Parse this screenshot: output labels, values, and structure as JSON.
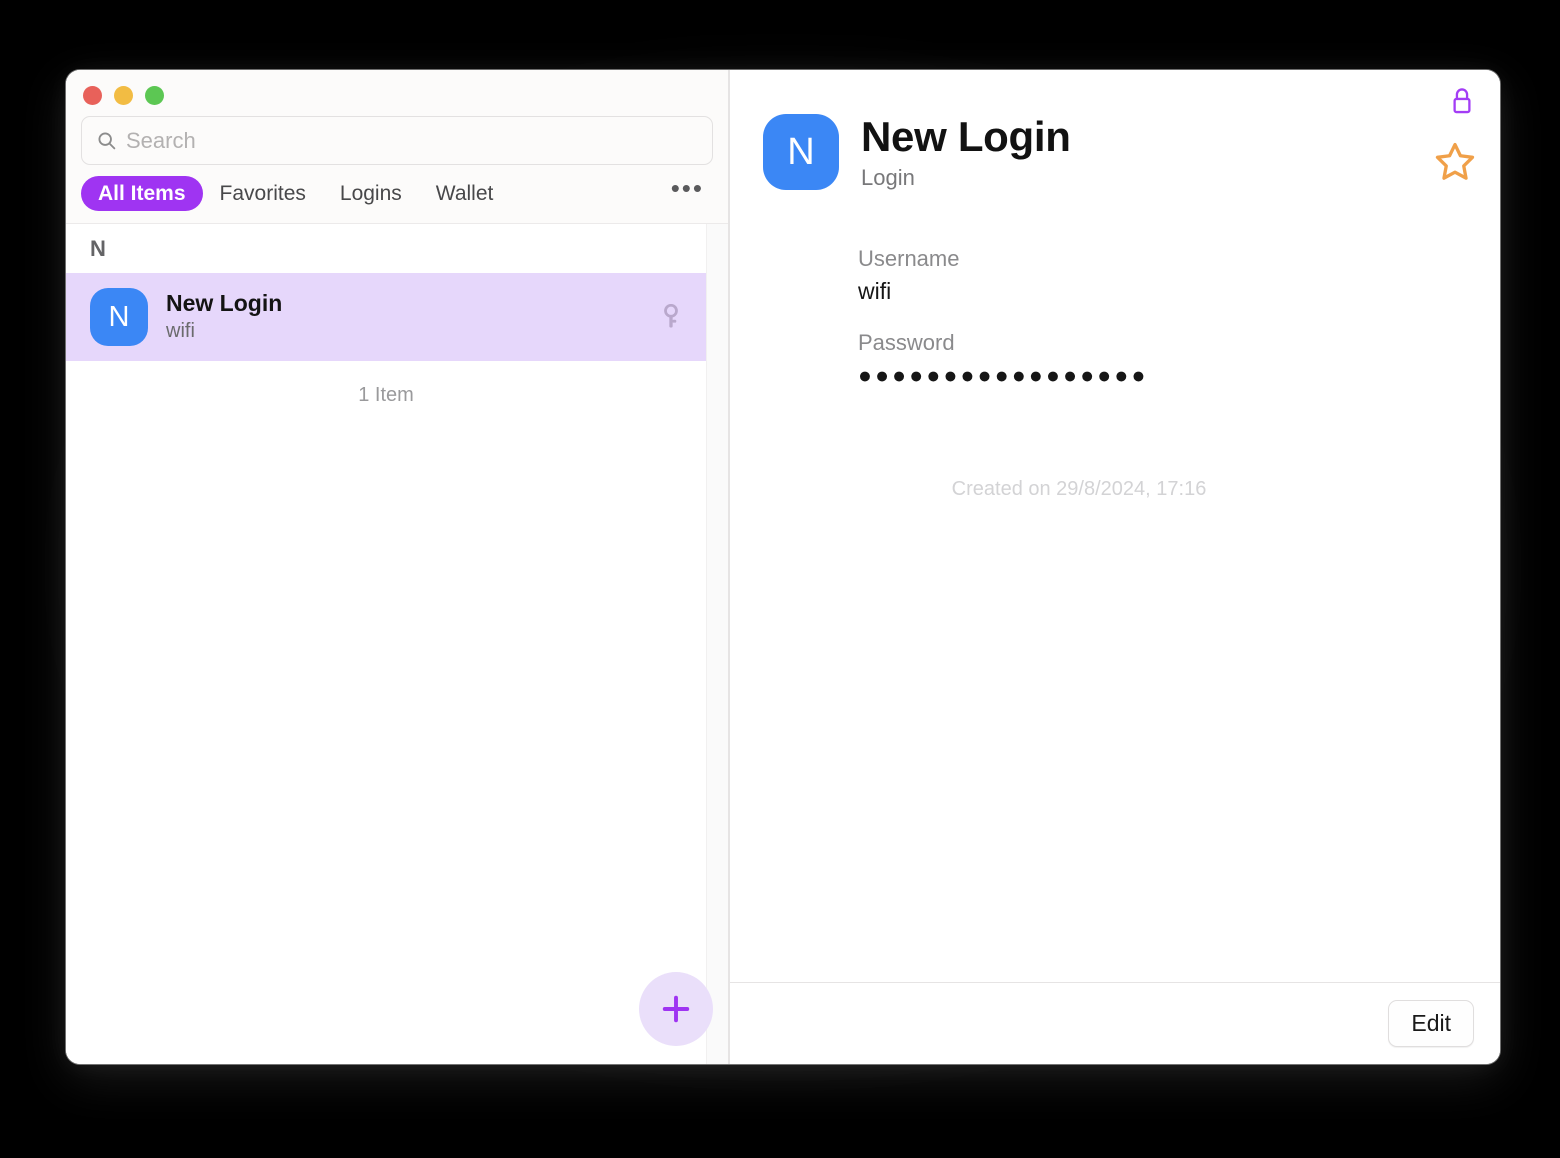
{
  "window": {
    "traffic_lights": [
      {
        "name": "close",
        "color": "#e8615a"
      },
      {
        "name": "minimize",
        "color": "#f2bc43"
      },
      {
        "name": "maximize",
        "color": "#5cc753"
      }
    ]
  },
  "sidebar": {
    "search": {
      "placeholder": "Search",
      "value": "",
      "icon": "search-icon"
    },
    "tabs": [
      {
        "label": "All Items",
        "active": true
      },
      {
        "label": "Favorites",
        "active": false
      },
      {
        "label": "Logins",
        "active": false
      },
      {
        "label": "Wallet",
        "active": false
      }
    ],
    "more_label": "•••",
    "section_header": "N",
    "items": [
      {
        "icon_letter": "N",
        "title": "New Login",
        "subtitle": "wifi",
        "trailing_icon": "key-icon",
        "selected": true
      }
    ],
    "item_count": "1 Item",
    "add_button_label": "+"
  },
  "detail": {
    "icon_letter": "N",
    "title": "New Login",
    "subtitle": "Login",
    "lock_icon": "lock-closed-icon",
    "favorite_icon": "star-outline-icon",
    "fields": [
      {
        "label": "Username",
        "value": "wifi",
        "masked": false
      },
      {
        "label": "Password",
        "value": "●●●●●●●●●●●●●●●●●",
        "masked": true
      }
    ],
    "created_text": "Created on 29/8/2024, 17:16",
    "edit_label": "Edit"
  },
  "colors": {
    "accent_purple": "#9f34f2",
    "selection": "#e6d7fb",
    "app_icon_blue": "#3b87f5",
    "lock_purple": "#a33df5",
    "star_orange": "#f0a049"
  }
}
